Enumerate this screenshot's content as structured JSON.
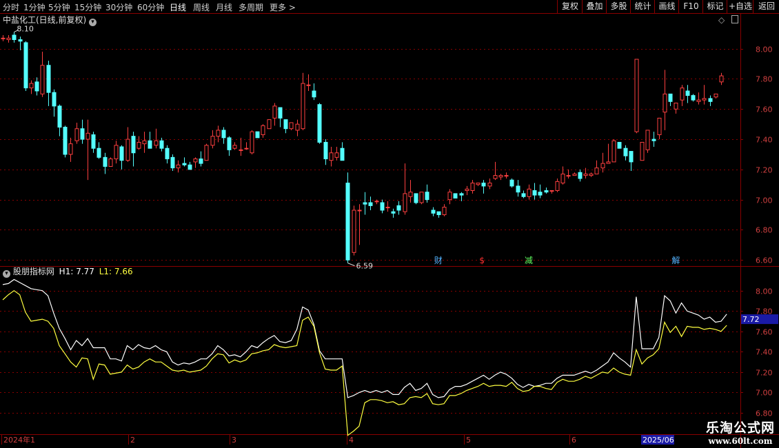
{
  "toolbar": {
    "timeframes": [
      {
        "label": "分时",
        "active": false
      },
      {
        "label": "1分钟",
        "active": false
      },
      {
        "label": "5分钟",
        "active": false
      },
      {
        "label": "15分钟",
        "active": false
      },
      {
        "label": "30分钟",
        "active": false
      },
      {
        "label": "60分钟",
        "active": false
      },
      {
        "label": "日线",
        "active": true
      },
      {
        "label": "周线",
        "active": false
      },
      {
        "label": "月线",
        "active": false
      },
      {
        "label": "多周期",
        "active": false
      },
      {
        "label": "更多 >",
        "active": false
      }
    ],
    "right_buttons": [
      "复权",
      "叠加",
      "多股",
      "统计",
      "画线",
      "F10",
      "标记",
      "+自选",
      "返回"
    ]
  },
  "chart_header": {
    "title": "中盐化工(日线,前复权)",
    "dropdown_icon": "chevron-down-icon"
  },
  "indicator_header": {
    "name": "股朋指标网",
    "h1_label": "H1: 7.77",
    "l1_label": "L1: 7.66"
  },
  "colors": {
    "up": "#ff4040",
    "down": "#54ffff",
    "h1": "#ffffff",
    "l1": "#ffff40",
    "grid": "#8b0000",
    "axis_text": "#d04040"
  },
  "chart_data": [
    {
      "type": "candlestick",
      "price_ticks": [
        "8.00",
        "7.80",
        "7.60",
        "7.40",
        "7.20",
        "7.00",
        "6.80",
        "6.60"
      ],
      "ylim": [
        6.56,
        8.14
      ],
      "max_label": "8.10",
      "min_label": "6.59",
      "candles": [
        [
          8.07,
          8.07,
          8.09,
          8.05
        ],
        [
          8.06,
          8.07,
          8.09,
          8.04
        ],
        [
          8.09,
          8.06,
          8.11,
          8.04
        ],
        [
          8.06,
          8.05,
          8.08,
          7.99
        ],
        [
          8.04,
          7.74,
          8.05,
          7.72
        ],
        [
          7.74,
          7.77,
          7.79,
          7.7
        ],
        [
          7.78,
          7.72,
          7.81,
          7.69
        ],
        [
          7.7,
          7.89,
          7.98,
          7.68
        ],
        [
          7.89,
          7.71,
          7.92,
          7.62
        ],
        [
          7.71,
          7.62,
          7.73,
          7.55
        ],
        [
          7.62,
          7.48,
          7.63,
          7.42
        ],
        [
          7.48,
          7.3,
          7.49,
          7.28
        ],
        [
          7.3,
          7.37,
          7.41,
          7.25
        ],
        [
          7.39,
          7.47,
          7.51,
          7.37
        ],
        [
          7.47,
          7.4,
          7.53,
          7.37
        ],
        [
          7.4,
          7.44,
          7.53,
          7.13
        ],
        [
          7.43,
          7.34,
          7.45,
          7.31
        ],
        [
          7.34,
          7.28,
          7.38,
          7.27
        ],
        [
          7.28,
          7.22,
          7.31,
          7.17
        ],
        [
          7.22,
          7.27,
          7.28,
          7.24
        ],
        [
          7.27,
          7.36,
          7.39,
          7.24
        ],
        [
          7.35,
          7.26,
          7.36,
          7.2
        ],
        [
          7.26,
          7.4,
          7.48,
          7.25
        ],
        [
          7.42,
          7.31,
          7.45,
          7.22
        ],
        [
          7.34,
          7.38,
          7.42,
          7.33
        ],
        [
          7.37,
          7.39,
          7.45,
          7.31
        ],
        [
          7.39,
          7.34,
          7.45,
          7.35
        ],
        [
          7.36,
          7.39,
          7.47,
          7.34
        ],
        [
          7.39,
          7.34,
          7.41,
          7.32
        ],
        [
          7.34,
          7.27,
          7.36,
          7.24
        ],
        [
          7.28,
          7.21,
          7.3,
          7.19
        ],
        [
          7.21,
          7.23,
          7.26,
          7.18
        ],
        [
          7.24,
          7.23,
          7.28,
          7.22
        ],
        [
          7.23,
          7.2,
          7.25,
          7.2
        ],
        [
          7.25,
          7.27,
          7.28,
          7.21
        ],
        [
          7.27,
          7.24,
          7.32,
          7.22
        ],
        [
          7.26,
          7.36,
          7.37,
          7.26
        ],
        [
          7.36,
          7.42,
          7.46,
          7.34
        ],
        [
          7.42,
          7.46,
          7.49,
          7.38
        ],
        [
          7.46,
          7.41,
          7.48,
          7.37
        ],
        [
          7.41,
          7.33,
          7.42,
          7.29
        ],
        [
          7.34,
          7.36,
          7.38,
          7.33
        ],
        [
          7.33,
          7.33,
          7.41,
          7.29
        ],
        [
          7.34,
          7.34,
          7.38,
          7.33
        ],
        [
          7.31,
          7.45,
          7.46,
          7.3
        ],
        [
          7.45,
          7.41,
          7.45,
          7.43
        ],
        [
          7.43,
          7.49,
          7.5,
          7.41
        ],
        [
          7.47,
          7.53,
          7.53,
          7.48
        ],
        [
          7.54,
          7.62,
          7.64,
          7.49
        ],
        [
          7.61,
          7.54,
          7.59,
          7.48
        ],
        [
          7.53,
          7.47,
          7.49,
          7.44
        ],
        [
          7.47,
          7.51,
          7.51,
          7.46
        ],
        [
          7.46,
          7.5,
          7.53,
          7.42
        ],
        [
          7.47,
          7.77,
          7.84,
          7.46
        ],
        [
          7.76,
          7.76,
          7.83,
          7.72
        ],
        [
          7.72,
          7.68,
          7.77,
          7.66
        ],
        [
          7.63,
          7.38,
          7.64,
          7.37
        ],
        [
          7.38,
          7.27,
          7.4,
          7.23
        ],
        [
          7.26,
          7.31,
          7.35,
          7.22
        ],
        [
          7.28,
          7.31,
          7.35,
          7.26
        ],
        [
          7.34,
          7.26,
          7.38,
          7.26
        ],
        [
          7.11,
          6.6,
          7.18,
          6.58
        ],
        [
          6.65,
          6.93,
          6.96,
          6.63
        ],
        [
          6.93,
          6.93,
          6.97,
          6.7
        ],
        [
          6.98,
          6.97,
          7.05,
          6.9
        ],
        [
          6.98,
          6.96,
          7.02,
          6.93
        ],
        [
          6.99,
          6.99,
          7.0,
          6.97
        ],
        [
          6.98,
          6.93,
          7.0,
          6.91
        ],
        [
          6.95,
          6.95,
          6.99,
          6.92
        ],
        [
          6.92,
          6.91,
          6.94,
          6.88
        ],
        [
          6.96,
          6.93,
          6.99,
          6.9
        ],
        [
          6.92,
          7.04,
          7.24,
          6.9
        ],
        [
          7.02,
          7.05,
          7.13,
          6.98
        ],
        [
          7.04,
          6.98,
          7.04,
          6.97
        ],
        [
          6.98,
          7.05,
          7.05,
          6.97
        ],
        [
          7.05,
          7.0,
          7.1,
          6.98
        ],
        [
          6.93,
          6.91,
          6.95,
          6.89
        ],
        [
          6.92,
          6.9,
          6.92,
          6.88
        ],
        [
          6.9,
          6.95,
          6.97,
          6.89
        ],
        [
          7.0,
          7.05,
          7.07,
          6.97
        ],
        [
          7.04,
          7.01,
          7.04,
          7.01
        ],
        [
          7.04,
          7.03,
          7.05,
          6.99
        ],
        [
          7.06,
          7.07,
          7.09,
          7.03
        ],
        [
          7.06,
          7.11,
          7.13,
          7.04
        ],
        [
          7.1,
          7.11,
          7.11,
          7.09
        ],
        [
          7.11,
          7.09,
          7.13,
          7.04
        ],
        [
          7.09,
          7.11,
          7.14,
          7.07
        ],
        [
          7.14,
          7.16,
          7.25,
          7.13
        ],
        [
          7.15,
          7.16,
          7.17,
          7.13
        ],
        [
          7.16,
          7.16,
          7.18,
          7.14
        ],
        [
          7.13,
          7.09,
          7.14,
          7.08
        ],
        [
          7.09,
          7.05,
          7.13,
          7.02
        ],
        [
          7.04,
          7.02,
          7.06,
          7.01
        ],
        [
          7.02,
          7.07,
          7.1,
          7.0
        ],
        [
          7.06,
          7.03,
          7.11,
          7.0
        ],
        [
          7.05,
          7.03,
          7.1,
          7.01
        ],
        [
          7.06,
          7.05,
          7.08,
          7.04
        ],
        [
          7.06,
          7.06,
          7.06,
          7.04
        ],
        [
          7.06,
          7.12,
          7.14,
          7.05
        ],
        [
          7.11,
          7.17,
          7.22,
          7.1
        ],
        [
          7.16,
          7.16,
          7.2,
          7.14
        ],
        [
          7.16,
          7.17,
          7.18,
          7.16
        ],
        [
          7.18,
          7.14,
          7.2,
          7.12
        ],
        [
          7.16,
          7.17,
          7.21,
          7.14
        ],
        [
          7.16,
          7.17,
          7.18,
          7.15
        ],
        [
          7.17,
          7.21,
          7.26,
          7.17
        ],
        [
          7.21,
          7.24,
          7.31,
          7.18
        ],
        [
          7.24,
          7.25,
          7.37,
          7.24
        ],
        [
          7.25,
          7.39,
          7.4,
          7.25
        ],
        [
          7.38,
          7.34,
          7.38,
          7.34
        ],
        [
          7.34,
          7.29,
          7.36,
          7.26
        ],
        [
          7.32,
          7.25,
          7.32,
          7.19
        ],
        [
          7.45,
          7.93,
          7.93,
          7.44
        ],
        [
          7.26,
          7.38,
          7.38,
          7.29
        ],
        [
          7.33,
          7.46,
          7.46,
          7.31
        ],
        [
          7.4,
          7.39,
          7.45,
          7.35
        ],
        [
          7.43,
          7.54,
          7.54,
          7.4
        ],
        [
          7.58,
          7.7,
          7.86,
          7.46
        ],
        [
          7.7,
          7.65,
          7.69,
          7.62
        ],
        [
          7.6,
          7.64,
          7.64,
          7.57
        ],
        [
          7.66,
          7.74,
          7.76,
          7.62
        ],
        [
          7.72,
          7.69,
          7.76,
          7.64
        ],
        [
          7.69,
          7.66,
          7.7,
          7.65
        ],
        [
          7.65,
          7.66,
          7.71,
          7.63
        ],
        [
          7.66,
          7.67,
          7.76,
          7.63
        ],
        [
          7.67,
          7.65,
          7.69,
          7.62
        ],
        [
          7.68,
          7.7,
          7.69,
          7.67
        ],
        [
          7.78,
          7.82,
          7.84,
          7.76
        ]
      ],
      "events": [
        {
          "label": "财",
          "color": "#54b4ff"
        },
        {
          "label": "$",
          "color": "#ff3030"
        },
        {
          "label": "减",
          "color": "#60ff60"
        },
        {
          "label": "解",
          "color": "#54b4ff"
        }
      ]
    },
    {
      "type": "line",
      "name": "股朋指标网",
      "price_ticks": [
        "8.00",
        "7.80",
        "7.60",
        "7.40",
        "7.20",
        "7.00",
        "6.80"
      ],
      "ylim": [
        6.78,
        8.12
      ],
      "current_value_label": "7.72",
      "series": [
        {
          "name": "H1",
          "values": [
            8.06,
            8.07,
            8.11,
            8.08,
            8.05,
            8.02,
            8.01,
            8.0,
            7.95,
            7.78,
            7.63,
            7.53,
            7.42,
            7.51,
            7.46,
            7.53,
            7.44,
            7.44,
            7.44,
            7.33,
            7.33,
            7.31,
            7.46,
            7.42,
            7.47,
            7.44,
            7.43,
            7.46,
            7.42,
            7.4,
            7.3,
            7.27,
            7.29,
            7.28,
            7.3,
            7.33,
            7.33,
            7.38,
            7.46,
            7.42,
            7.36,
            7.37,
            7.35,
            7.4,
            7.46,
            7.44,
            7.49,
            7.53,
            7.56,
            7.5,
            7.49,
            7.51,
            7.62,
            7.84,
            7.81,
            7.67,
            7.41,
            7.33,
            7.33,
            7.33,
            7.33,
            6.95,
            6.97,
            7.0,
            7.02,
            7.0,
            7.02,
            7.0,
            7.02,
            6.98,
            6.98,
            7.05,
            7.09,
            7.02,
            7.04,
            7.09,
            6.98,
            6.95,
            6.96,
            7.03,
            7.06,
            7.06,
            7.08,
            7.11,
            7.14,
            7.17,
            7.13,
            7.17,
            7.2,
            7.18,
            7.14,
            7.08,
            7.05,
            7.08,
            7.06,
            7.07,
            7.09,
            7.09,
            7.14,
            7.17,
            7.17,
            7.17,
            7.19,
            7.21,
            7.19,
            7.22,
            7.26,
            7.3,
            7.39,
            7.34,
            7.3,
            7.25,
            7.94,
            7.43,
            7.43,
            7.43,
            7.54,
            7.95,
            7.9,
            7.78,
            7.88,
            7.8,
            7.78,
            7.76,
            7.72,
            7.74,
            7.69,
            7.7,
            7.77
          ]
        },
        {
          "name": "L1",
          "values": [
            7.91,
            7.96,
            8.0,
            7.96,
            7.79,
            7.7,
            7.71,
            7.72,
            7.7,
            7.63,
            7.46,
            7.38,
            7.3,
            7.25,
            7.34,
            7.33,
            7.13,
            7.28,
            7.27,
            7.18,
            7.19,
            7.2,
            7.27,
            7.23,
            7.25,
            7.3,
            7.33,
            7.3,
            7.3,
            7.26,
            7.22,
            7.21,
            7.22,
            7.2,
            7.21,
            7.22,
            7.26,
            7.33,
            7.38,
            7.37,
            7.29,
            7.32,
            7.3,
            7.32,
            7.38,
            7.39,
            7.41,
            7.42,
            7.47,
            7.45,
            7.44,
            7.45,
            7.46,
            7.71,
            7.74,
            7.65,
            7.39,
            7.23,
            7.22,
            7.22,
            7.26,
            6.58,
            6.62,
            6.67,
            6.9,
            6.93,
            6.93,
            6.92,
            6.9,
            6.91,
            6.88,
            6.89,
            6.95,
            6.96,
            6.95,
            6.99,
            6.89,
            6.88,
            6.89,
            6.97,
            6.97,
            6.99,
            7.02,
            7.04,
            7.06,
            7.09,
            7.06,
            7.07,
            7.07,
            7.06,
            7.1,
            7.04,
            7.01,
            7.02,
            7.06,
            7.06,
            7.04,
            7.03,
            7.1,
            7.13,
            7.11,
            7.11,
            7.13,
            7.16,
            7.14,
            7.17,
            7.2,
            7.19,
            7.24,
            7.2,
            7.18,
            7.17,
            7.42,
            7.28,
            7.34,
            7.37,
            7.43,
            7.69,
            7.59,
            7.65,
            7.55,
            7.65,
            7.64,
            7.64,
            7.62,
            7.63,
            7.62,
            7.6,
            7.66
          ]
        }
      ]
    }
  ],
  "time_axis": {
    "labels": [
      "2024年1",
      "2",
      "3",
      "4",
      "5",
      "6"
    ],
    "highlight_label": "2025/06"
  },
  "watermark": {
    "line1": "乐淘公式网",
    "line2": "www.60lt.com"
  }
}
